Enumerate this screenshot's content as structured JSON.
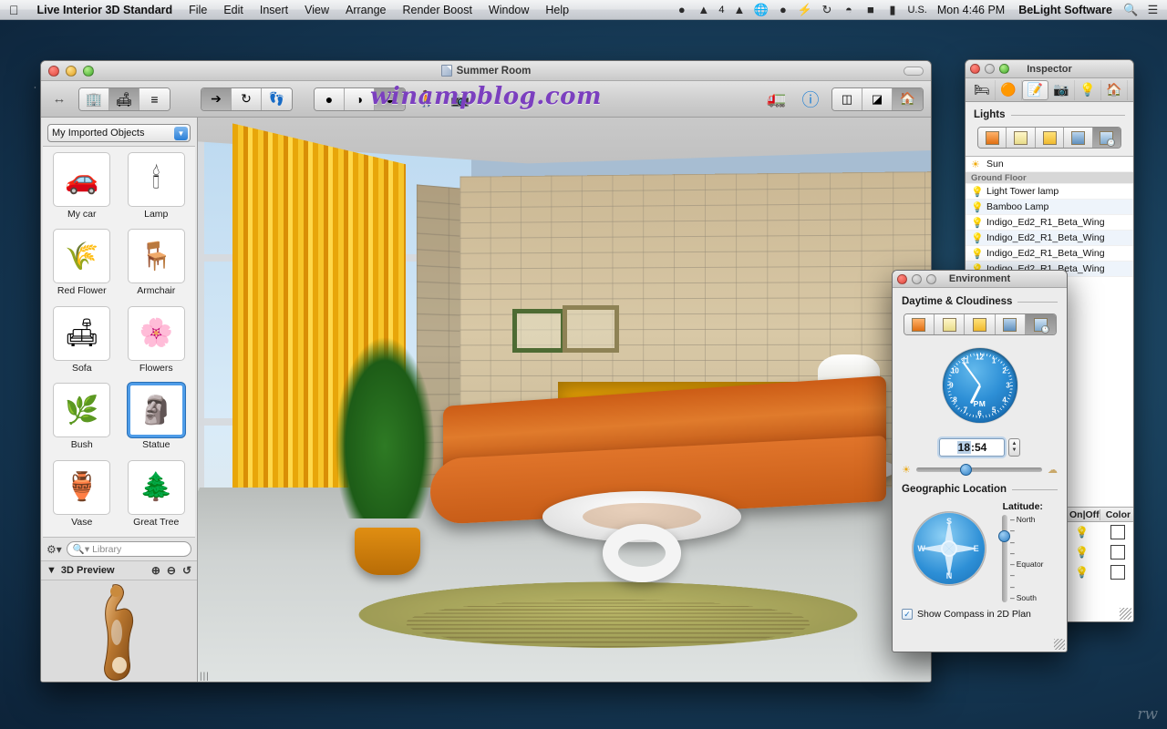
{
  "menubar": {
    "apple_icon": "apple-icon",
    "app_name": "Live Interior 3D Standard",
    "menus": [
      "File",
      "Edit",
      "Insert",
      "View",
      "Arrange",
      "Render Boost",
      "Window",
      "Help"
    ],
    "status_icons": [
      "dropbox-check-icon",
      "adobe-icon",
      "google-drive-icon",
      "globe-icon",
      "evernote-icon",
      "flash-icon",
      "timemachine-icon",
      "wifi-icon",
      "battery-icon"
    ],
    "adobe_badge": "4",
    "flag_icon": "us-flag-icon",
    "locale": "U.S.",
    "clock": "Mon 4:46 PM",
    "owner": "BeLight Software",
    "search_icon": "search-icon",
    "notifications_icon": "notification-center-icon"
  },
  "main_window": {
    "title": "Summer Room",
    "doc_icon": "document-icon",
    "traffic": [
      "close-button",
      "minimize-button",
      "zoom-button"
    ],
    "toolbar": {
      "leading_icon": "swap-arrows-icon",
      "group1": [
        {
          "name": "building-view-button",
          "icon": "🏢",
          "active": false
        },
        {
          "name": "furniture-view-button",
          "icon": "🛋",
          "active": true
        },
        {
          "name": "list-view-button",
          "icon": "≣",
          "active": false
        }
      ],
      "group2": [
        {
          "name": "select-tool-button",
          "icon": "↖",
          "active": true
        },
        {
          "name": "rotate-tool-button",
          "icon": "↻",
          "active": false
        },
        {
          "name": "walk-tool-button",
          "icon": "👣",
          "active": false
        }
      ],
      "group3": [
        {
          "name": "flat-shading-button",
          "icon": "●",
          "active": false
        },
        {
          "name": "gradient-shading-button",
          "icon": "◕",
          "active": false
        },
        {
          "name": "realistic-shading-button",
          "icon": "◓",
          "active": true
        }
      ],
      "walk_icon": "walking-person-icon",
      "camera_icon": "camera-icon",
      "render_icon": "render-boost-icon",
      "info_icon": "info-icon",
      "layout_buttons": [
        {
          "name": "split-view-button",
          "icon": "▣",
          "active": false
        },
        {
          "name": "plan-3d-view-button",
          "icon": "▤",
          "active": false
        },
        {
          "name": "3d-view-button",
          "icon": "🏠",
          "active": true
        }
      ],
      "pill_button": "toolbar-toggle-button"
    },
    "watermark": "winampblog.com"
  },
  "sidebar": {
    "library_popup": "My Imported Objects",
    "objects": [
      {
        "label": "My car",
        "icon": "🚗"
      },
      {
        "label": "Lamp",
        "icon": "🕯"
      },
      {
        "label": "Red Flower",
        "icon": "🌾"
      },
      {
        "label": "Armchair",
        "icon": "🪑"
      },
      {
        "label": "Sofa",
        "icon": "🛋"
      },
      {
        "label": "Flowers",
        "icon": "🌸"
      },
      {
        "label": "Bush",
        "icon": "🌿"
      },
      {
        "label": "Statue",
        "icon": "🗿",
        "selected": true
      },
      {
        "label": "Vase",
        "icon": "🏺"
      },
      {
        "label": "Great Tree",
        "icon": "🌲"
      }
    ],
    "gear_icon": "gear-menu-icon",
    "search_placeholder": "Library",
    "search_icon": "search-icon",
    "preview": {
      "disclosure_icon": "disclosure-triangle-icon",
      "title": "3D Preview",
      "zoom_in_icon": "zoom-in-icon",
      "zoom_out_icon": "zoom-out-icon",
      "rotate_icon": "rotate-icon",
      "object": "statue-preview"
    }
  },
  "inspector": {
    "title": "Inspector",
    "tabs": [
      {
        "name": "object-tab",
        "icon": "🛏",
        "active": false
      },
      {
        "name": "material-tab",
        "icon": "🟠",
        "active": false
      },
      {
        "name": "edit-tab",
        "icon": "📝",
        "active": true
      },
      {
        "name": "camera-tab",
        "icon": "📷",
        "active": false
      },
      {
        "name": "light-tab",
        "icon": "💡",
        "active": false
      },
      {
        "name": "building-tab",
        "icon": "🏠",
        "active": false
      }
    ],
    "section_title": "Lights",
    "light_mode_buttons": [
      {
        "name": "lights-warm-button",
        "active": false
      },
      {
        "name": "lights-neutral-button",
        "active": false
      },
      {
        "name": "lights-bright-button",
        "active": false
      },
      {
        "name": "lights-night-button",
        "active": false
      },
      {
        "name": "lights-auto-time-button",
        "active": true
      }
    ],
    "lights": [
      {
        "label": "Sun",
        "icon": "sun-icon",
        "type": "sun"
      },
      {
        "label": "Ground Floor",
        "type": "group"
      },
      {
        "label": "Light Tower lamp",
        "icon": "bulb-on-icon",
        "type": "light"
      },
      {
        "label": "Bamboo Lamp",
        "icon": "bulb-off-icon",
        "type": "light"
      },
      {
        "label": "Indigo_Ed2_R1_Beta_Wing",
        "icon": "bulb-off-icon",
        "type": "light"
      },
      {
        "label": "Indigo_Ed2_R1_Beta_Wing",
        "icon": "bulb-off-icon",
        "type": "light"
      },
      {
        "label": "Indigo_Ed2_R1_Beta_Wing",
        "icon": "bulb-off-icon",
        "type": "light"
      },
      {
        "label": "Indigo_Ed2_R1_Beta_Wing",
        "icon": "bulb-off-icon",
        "type": "light"
      }
    ],
    "table": {
      "columns": [
        "On|Off",
        "Color"
      ],
      "rows": [
        {
          "onoff": "bulb-on-icon",
          "color": "#ffffff"
        },
        {
          "onoff": "bulb-off-icon",
          "color": "#ffffff"
        },
        {
          "onoff": "bulb-on-icon",
          "color": "#ffffff"
        }
      ]
    }
  },
  "environment": {
    "title": "Environment",
    "daytime_section": "Daytime & Cloudiness",
    "daytime_buttons": [
      {
        "name": "daytime-morning-button",
        "active": false
      },
      {
        "name": "daytime-noon-button",
        "active": false
      },
      {
        "name": "daytime-evening-button",
        "active": false
      },
      {
        "name": "daytime-night-button",
        "active": false
      },
      {
        "name": "daytime-custom-button",
        "active": true
      }
    ],
    "clock": {
      "numbers": [
        "12",
        "1",
        "2",
        "3",
        "4",
        "5",
        "6",
        "7",
        "8",
        "9",
        "10",
        "11"
      ],
      "meridiem": "PM"
    },
    "time_value": "18:54",
    "time_value_hours": "18",
    "time_value_rest": ":54",
    "stepper_up": "▲",
    "stepper_down": "▼",
    "slider_sun_icon": "sun-icon",
    "slider_cloud_icon": "cloud-icon",
    "slider_position_pct": 35,
    "geo_section": "Geographic Location",
    "compass": {
      "name": "compass-rose",
      "letters": [
        "N",
        "E",
        "S",
        "W"
      ]
    },
    "latitude_label": "Latitude:",
    "latitude_marks": [
      "North",
      "",
      "",
      "",
      "Equator",
      "",
      "",
      "South"
    ],
    "latitude_north": "North",
    "latitude_equator": "Equator",
    "latitude_south": "South",
    "checkbox_label": "Show Compass in 2D Plan",
    "checkbox_checked": true,
    "checkbox_glyph": "✓"
  },
  "colors": {
    "accent_blue": "#2d8fd6",
    "selection_blue": "#4e9ce8",
    "curtain_orange": "#f0a905",
    "sofa_orange": "#d8692a",
    "desktop_blue": "#1d4865",
    "watermark_purple": "#7b3fbf"
  }
}
